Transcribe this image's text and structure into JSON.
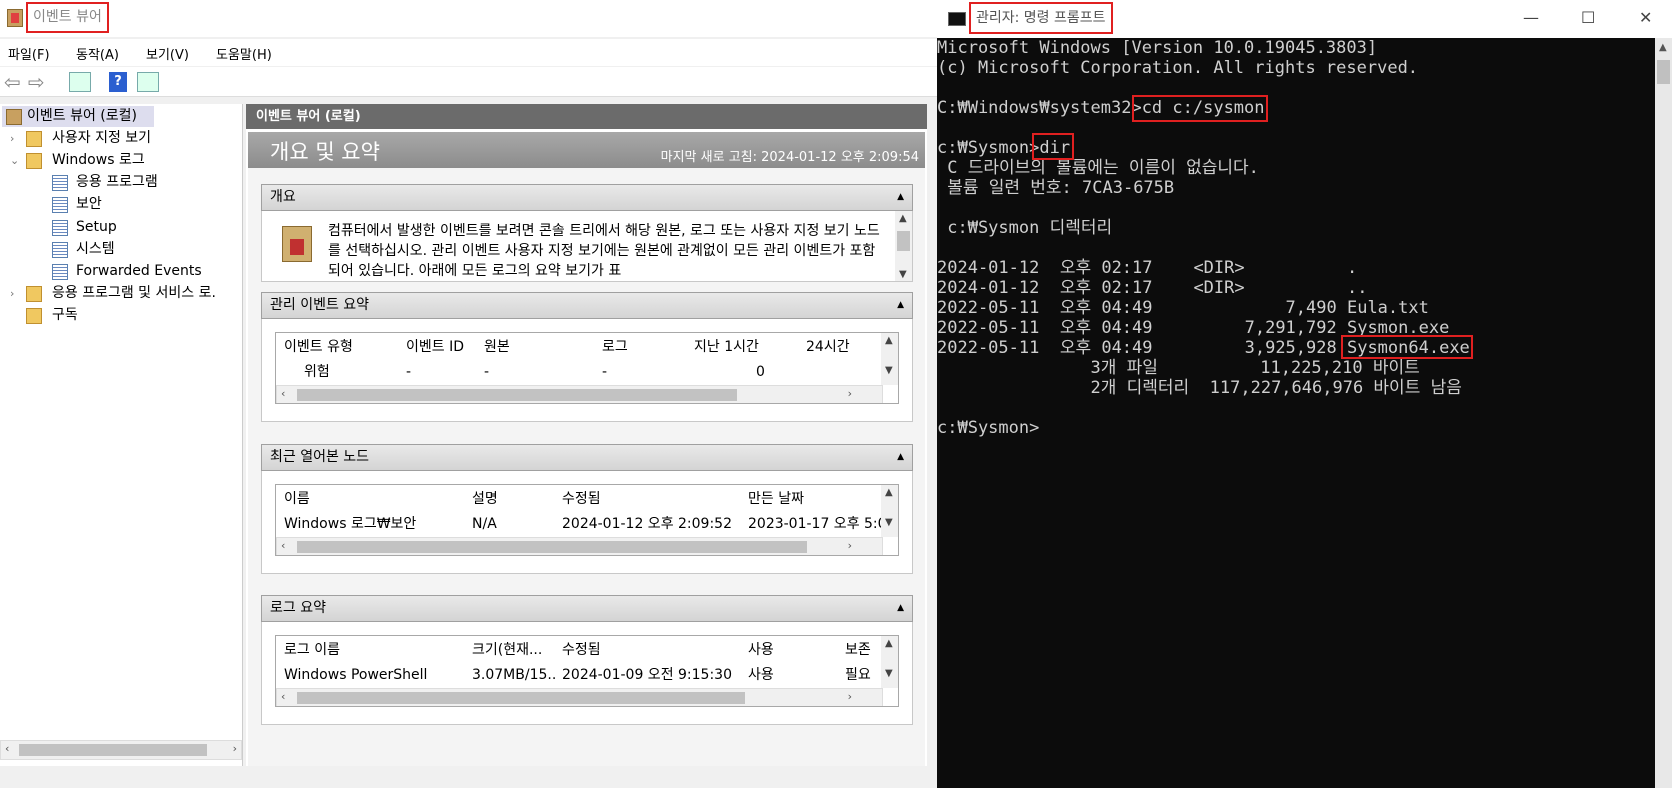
{
  "event_viewer": {
    "title": "이벤트 뷰어",
    "menu": [
      "파일(F)",
      "동작(A)",
      "보기(V)",
      "도움말(H)"
    ],
    "tree": {
      "root": "이벤트 뷰어 (로컬)",
      "custom_views": "사용자 지정 보기",
      "windows_logs": "Windows 로그",
      "logs": [
        "응용 프로그램",
        "보안",
        "Setup",
        "시스템",
        "Forwarded Events"
      ],
      "apps_services": "응용 프로그램 및 서비스 로.",
      "subscriptions": "구독"
    },
    "main": {
      "header": "이벤트 뷰어 (로컬)",
      "overview_title": "개요 및 요약",
      "last_refresh": "마지막 새로 고침: 2024-01-12 오후 2:09:54",
      "sections": {
        "overview": {
          "title": "개요",
          "text": "컴퓨터에서 발생한 이벤트를 보려면 콘솔 트리에서 해당 원본, 로그 또는 사용자 지정 보기 노드를 선택하십시오. 관리 이벤트 사용자 지정 보기에는 원본에 관계없이 모든 관리 이벤트가 포함되어 있습니다. 아래에 모든 로그의 요약 보기가 표"
        },
        "admin_events": {
          "title": "관리 이벤트 요약",
          "columns": [
            "이벤트 유형",
            "이벤트 ID",
            "원본",
            "로그",
            "지난 1시간",
            "24시간"
          ],
          "rows": [
            [
              "위험",
              "-",
              "-",
              "-",
              "0",
              ""
            ]
          ]
        },
        "recent_nodes": {
          "title": "최근 열어본 노드",
          "columns": [
            "이름",
            "설명",
            "수정됨",
            "만든 날짜"
          ],
          "rows": [
            [
              "Windows 로그₩보안",
              "N/A",
              "2024-01-12 오후 2:09:52",
              "2023-01-17 오후 5:0"
            ]
          ]
        },
        "log_summary": {
          "title": "로그 요약",
          "columns": [
            "로그 이름",
            "크기(현재...",
            "수정됨",
            "사용",
            "보존"
          ],
          "rows": [
            [
              "Windows PowerShell",
              "3.07MB/15...",
              "2024-01-09 오전 9:15:30",
              "사용",
              "필요"
            ]
          ]
        }
      }
    }
  },
  "cmd": {
    "title": "관리자: 명령 프롬프트",
    "lines": [
      "Microsoft Windows [Version 10.0.19045.3803]",
      "(c) Microsoft Corporation. All rights reserved.",
      "",
      "C:₩Windows₩system32>cd c:/sysmon",
      "",
      "c:₩Sysmon>dir",
      " C 드라이브의 볼륨에는 이름이 없습니다.",
      " 볼륨 일련 번호: 7CA3-675B",
      "",
      " c:₩Sysmon 디렉터리",
      "",
      "2024-01-12  오후 02:17    <DIR>          .",
      "2024-01-12  오후 02:17    <DIR>          ..",
      "2022-05-11  오후 04:49             7,490 Eula.txt",
      "2022-05-11  오후 04:49         7,291,792 Sysmon.exe",
      "2022-05-11  오후 04:49         3,925,928 Sysmon64.exe",
      "               3개 파일          11,225,210 바이트",
      "               2개 디렉터리  117,227,646,976 바이트 남음",
      "",
      "c:₩Sysmon>"
    ]
  }
}
